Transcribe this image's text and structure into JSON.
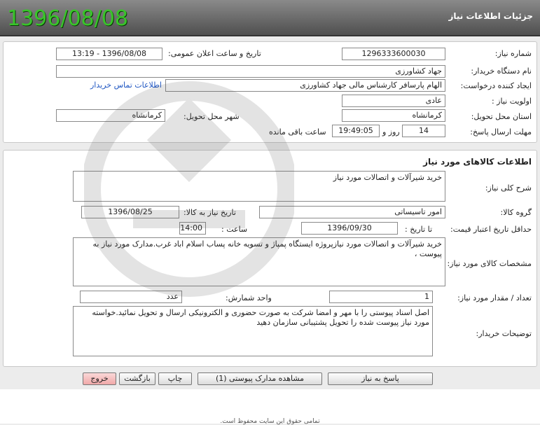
{
  "header": {
    "date": "1396/08/08",
    "title": "جزئیات اطلاعات نیاز"
  },
  "need_info": {
    "need_number_label": "شماره نیاز:",
    "need_number": "1296333600030",
    "announce_label": "تاریخ و ساعت اعلان عمومی:",
    "announce_value": "1396/08/08 - 13:19",
    "buyer_org_label": "نام دستگاه خریدار:",
    "buyer_org": "جهاد کشاورزی",
    "requester_label": "ایجاد کننده درخواست:",
    "requester": "الهام پارسافر کارشناس مالی جهاد کشاورزی",
    "contact_link": "اطلاعات تماس خریدار",
    "priority_label": "اولویت نیاز :",
    "priority": "عادی",
    "province_label": "استان محل تحویل:",
    "province": "کرمانشاه",
    "city_label": "شهر محل تحویل:",
    "city": "کرمانشاه",
    "deadline_label": "مهلت ارسال پاسخ:",
    "deadline_days": "14",
    "days_word": "روز و",
    "deadline_time": "19:49:05",
    "remaining_label": "ساعت باقی مانده"
  },
  "goods": {
    "section_title": "اطلاعات کالاهای مورد نیاز",
    "summary_label": "شرح کلی نیاز:",
    "summary": "خرید شیرآلات و اتصالات مورد نیاز",
    "group_label": "گروه کالا:",
    "group": "امور تاسیساتی",
    "need_date_label": "تاریخ نیاز به کالا:",
    "need_date": "1396/08/25",
    "validity_label": "حداقل تاریخ اعتبار قیمت:",
    "to_date_label": "تا تاریخ :",
    "to_date": "1396/09/30",
    "time_label": "ساعت :",
    "time": "14:00",
    "spec_label": "مشخصات کالای مورد نیاز:",
    "spec": "خرید شیرآلات و اتصالات مورد نیازپروژه ایستگاه پمپاژ و تسویه خانه پساب اسلام اباد غرب.مدارک مورد نیاز به پیوست ،",
    "qty_label": "تعداد / مقدار مورد نیاز:",
    "qty": "1",
    "unit_label": "واحد شمارش:",
    "unit": "عدد",
    "buyer_notes_label": "توضیحات خریدار:",
    "buyer_notes": "اصل اسناد پیوستی را با مهر و امضا شرکت به صورت حضوری و الکترونیکی ارسال و تحویل نمائید.خواسته مورد نیاز پیوست شده را تحویل پشتیبانی سازمان دهید"
  },
  "buttons": {
    "reply": "پاسخ به نیاز",
    "attachments": "مشاهده مدارک پیوستی (1)",
    "print": "چاپ",
    "back": "بازگشت",
    "exit": "خروج"
  },
  "footer": {
    "copyright": "تمامی حقوق این سایت محفوظ است."
  }
}
